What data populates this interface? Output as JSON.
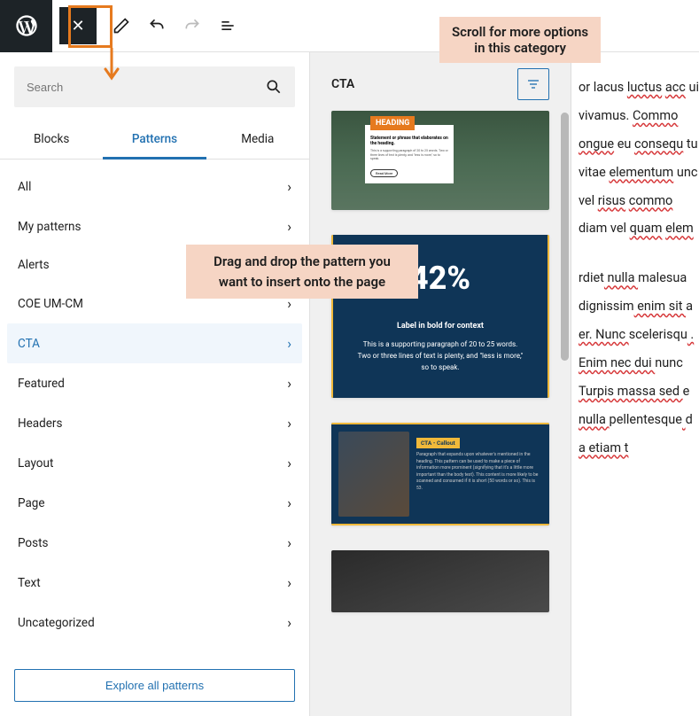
{
  "toolbar": {
    "close_label": "✕"
  },
  "search": {
    "placeholder": "Search"
  },
  "tabs": {
    "blocks": "Blocks",
    "patterns": "Patterns",
    "media": "Media"
  },
  "categories": [
    {
      "label": "All",
      "has_chevron": true,
      "selected": false
    },
    {
      "label": "My patterns",
      "has_chevron": true,
      "selected": false
    },
    {
      "label": "Alerts",
      "has_chevron": false,
      "selected": false
    },
    {
      "label": "COE UM-CM",
      "has_chevron": true,
      "selected": false
    },
    {
      "label": "CTA",
      "has_chevron": true,
      "selected": true
    },
    {
      "label": "Featured",
      "has_chevron": true,
      "selected": false
    },
    {
      "label": "Headers",
      "has_chevron": true,
      "selected": false
    },
    {
      "label": "Layout",
      "has_chevron": true,
      "selected": false
    },
    {
      "label": "Page",
      "has_chevron": true,
      "selected": false
    },
    {
      "label": "Posts",
      "has_chevron": true,
      "selected": false
    },
    {
      "label": "Text",
      "has_chevron": true,
      "selected": false
    },
    {
      "label": "Uncategorized",
      "has_chevron": true,
      "selected": false
    }
  ],
  "explore_label": "Explore all patterns",
  "preview": {
    "title": "CTA",
    "card1": {
      "heading": "HEADING",
      "sub": "Statement or phrase that elaborates on the heading.",
      "txt": "This is a supporting paragraph of 20 to 25 words. Two or three lines of text is plenty, and \"less is more,\" so to speak.",
      "btn": "Read More"
    },
    "card2": {
      "num": "42%",
      "label": "Label in bold for context",
      "txt": "This is a supporting paragraph of 20 to 25 words. Two or three lines of text is plenty, and \"less is more,\" so to speak."
    },
    "card3": {
      "head": "CTA - Callout",
      "body": "Paragraph that expands upon whatever's mentioned in the heading. This pattern can be used to make a piece of information more prominent (signifying that it's a little more important than the body text). This content is more likely to be scanned and consumed if it is short (50 words or so). This is 53."
    }
  },
  "callouts": {
    "scroll": "Scroll for more options\nin this category",
    "drag": "Drag and drop the pattern you want to insert onto the page"
  },
  "content": {
    "p1_parts": [
      "or lacus ",
      "luctus",
      " ",
      "acc",
      " ui vivamus. ",
      "Commo",
      " ",
      "ongue",
      " eu ",
      "consequ",
      " tu vitae ",
      "elementum",
      " unc vel ",
      "risus",
      " ",
      "commo",
      " diam vel ",
      "quam",
      " ",
      "elem"
    ],
    "p2_parts": [
      "rdiet",
      " nulla ",
      "malesua",
      " ",
      "dignissim",
      " enim sit ",
      "a",
      " er. Nunc ",
      "scelerisqu",
      " . Enim nec dui ",
      "nunc",
      " Turpis massa sed ",
      "e",
      " nulla ",
      "pellentesque",
      " ",
      "d",
      " a etiam t"
    ]
  }
}
